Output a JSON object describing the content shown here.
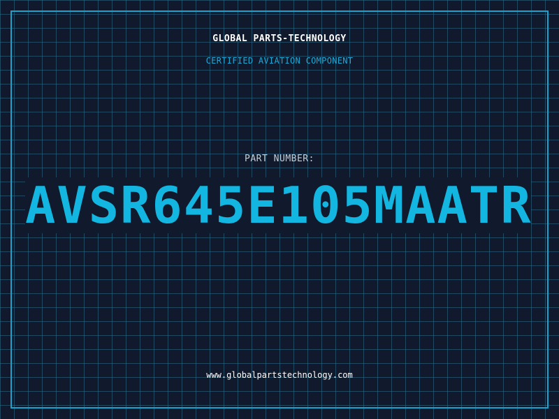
{
  "header": {
    "company": "GLOBAL PARTS-TECHNOLOGY",
    "tagline": "CERTIFIED AVIATION COMPONENT"
  },
  "part": {
    "label": "PART NUMBER:",
    "number": "AVSR645E105MAATR"
  },
  "footer": {
    "website": "www.globalpartstechnology.com"
  },
  "colors": {
    "background": "#101a2c",
    "grid": "#2e6e8c",
    "accent": "#12b6e0",
    "frame": "#1aa3cc",
    "text": "#ffffff"
  }
}
